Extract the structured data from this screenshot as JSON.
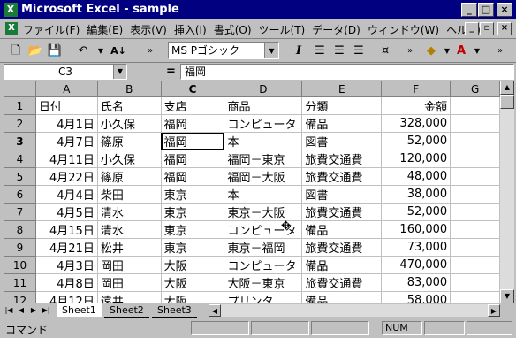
{
  "window": {
    "title": "Microsoft Excel - sample",
    "minimize": "_",
    "maximize": "□",
    "close": "×"
  },
  "menu": [
    "ファイル(F)",
    "編集(E)",
    "表示(V)",
    "挿入(I)",
    "書式(O)",
    "ツール(T)",
    "データ(D)",
    "ウィンドウ(W)",
    "ヘルプ(H)"
  ],
  "toolbar": {
    "font_name": "MS Pゴシック",
    "italic": "I"
  },
  "formula_bar": {
    "name_box": "C3",
    "eq": "=",
    "content": "福岡"
  },
  "sheet": {
    "columns": [
      "A",
      "B",
      "C",
      "D",
      "E",
      "F",
      "G"
    ],
    "rows": [
      {
        "num": "1",
        "A": "日付",
        "B": "氏名",
        "C": "支店",
        "D": "商品",
        "E": "分類",
        "F": "金額"
      },
      {
        "num": "2",
        "A": "4月1日",
        "B": "小久保",
        "C": "福岡",
        "D": "コンピュータ",
        "E": "備品",
        "F": "328,000"
      },
      {
        "num": "3",
        "A": "4月7日",
        "B": "篠原",
        "C": "福岡",
        "D": "本",
        "E": "図書",
        "F": "52,000"
      },
      {
        "num": "4",
        "A": "4月11日",
        "B": "小久保",
        "C": "福岡",
        "D": "福岡－東京",
        "E": "旅費交通費",
        "F": "120,000"
      },
      {
        "num": "5",
        "A": "4月22日",
        "B": "篠原",
        "C": "福岡",
        "D": "福岡－大阪",
        "E": "旅費交通費",
        "F": "48,000"
      },
      {
        "num": "6",
        "A": "4月4日",
        "B": "柴田",
        "C": "東京",
        "D": "本",
        "E": "図書",
        "F": "38,000"
      },
      {
        "num": "7",
        "A": "4月5日",
        "B": "清水",
        "C": "東京",
        "D": "東京－大阪",
        "E": "旅費交通費",
        "F": "52,000"
      },
      {
        "num": "8",
        "A": "4月15日",
        "B": "清水",
        "C": "東京",
        "D": "コンピュータ",
        "E": "備品",
        "F": "160,000"
      },
      {
        "num": "9",
        "A": "4月21日",
        "B": "松井",
        "C": "東京",
        "D": "東京－福岡",
        "E": "旅費交通費",
        "F": "73,000"
      },
      {
        "num": "10",
        "A": "4月3日",
        "B": "岡田",
        "C": "大阪",
        "D": "コンピュータ",
        "E": "備品",
        "F": "470,000"
      },
      {
        "num": "11",
        "A": "4月8日",
        "B": "岡田",
        "C": "大阪",
        "D": "大阪－東京",
        "E": "旅費交通費",
        "F": "83,000"
      },
      {
        "num": "12",
        "A": "4月12日",
        "B": "遠井",
        "C": "大阪",
        "D": "プリンタ",
        "E": "備品",
        "F": "58,000"
      },
      {
        "num": "13",
        "A": "",
        "B": "",
        "C": "",
        "D": "",
        "E": "",
        "F": ""
      }
    ]
  },
  "tabs": [
    "Sheet1",
    "Sheet2",
    "Sheet3"
  ],
  "status": {
    "mode": "コマンド",
    "num": "NUM"
  }
}
